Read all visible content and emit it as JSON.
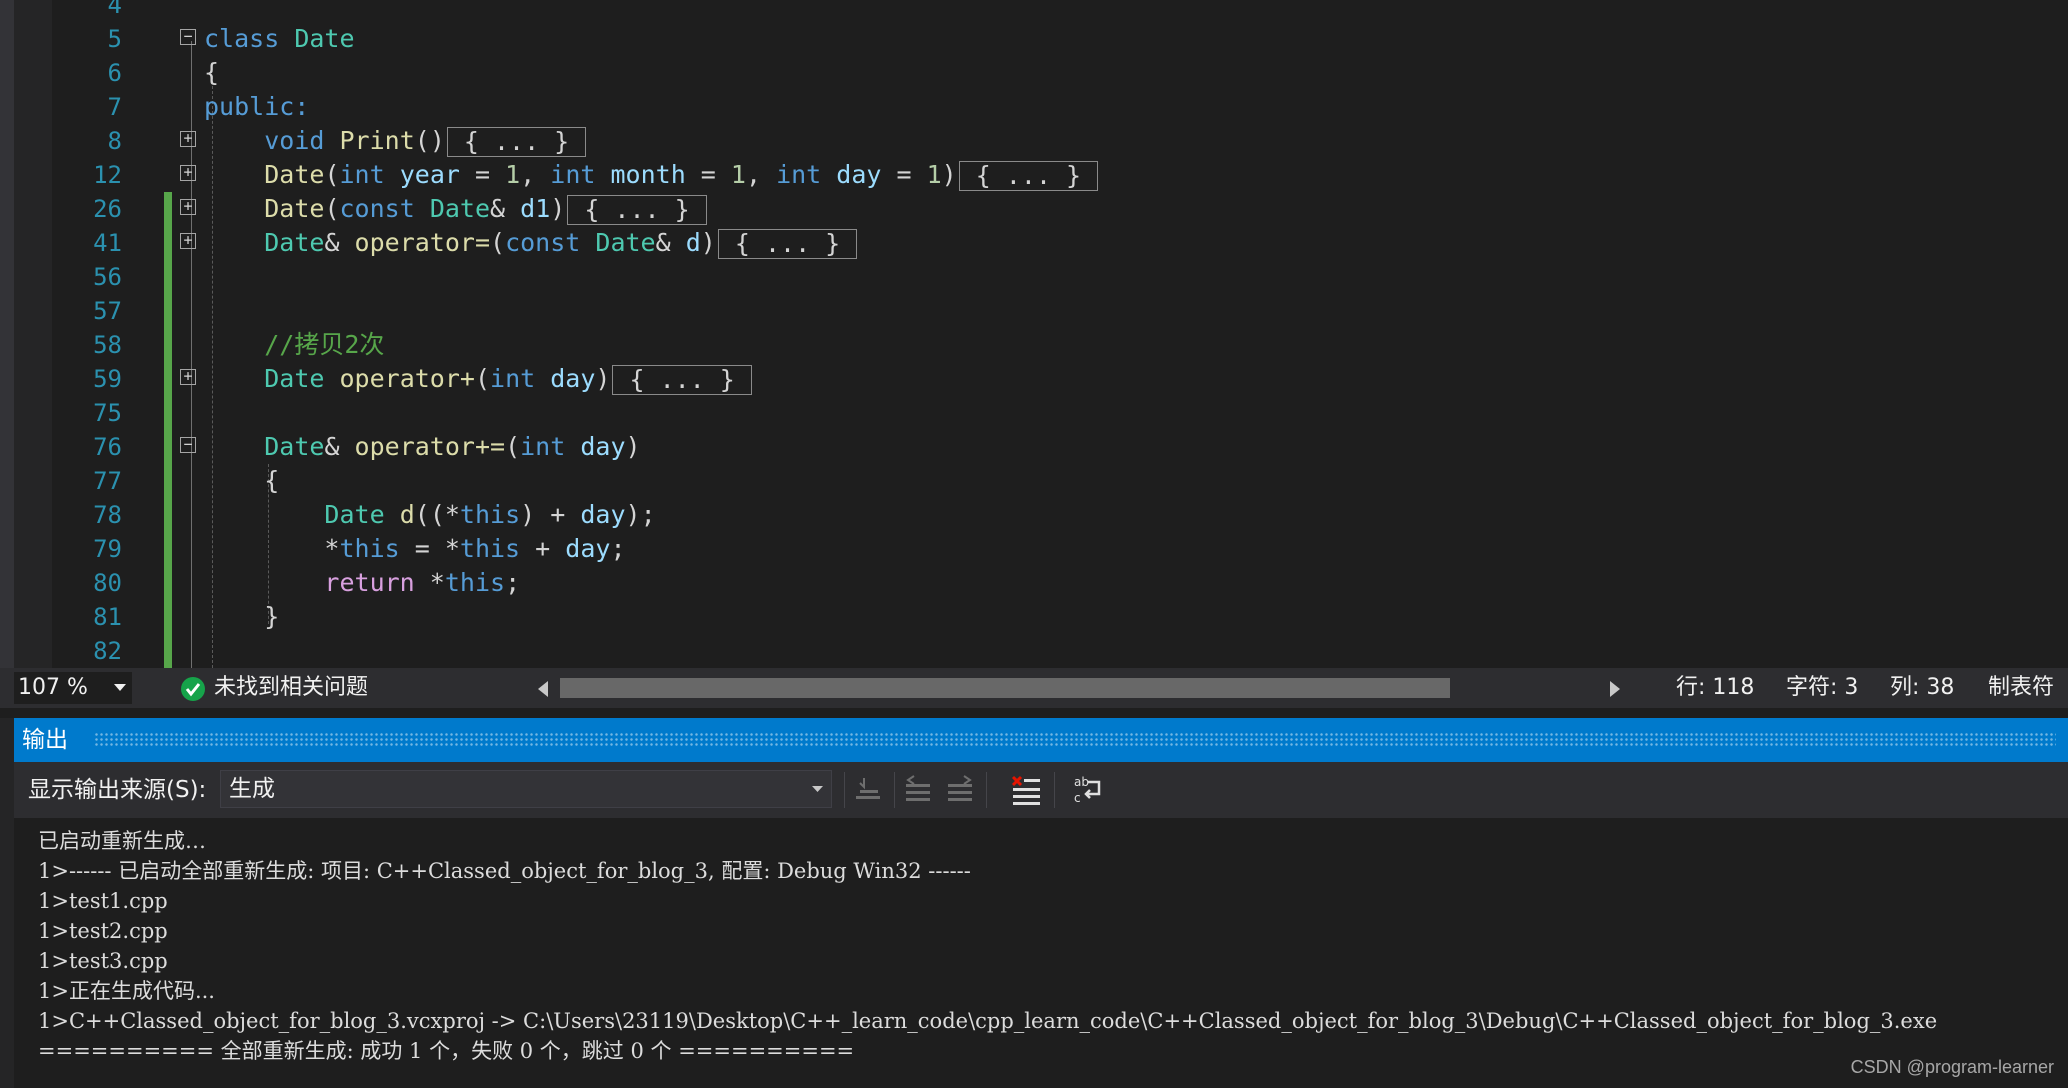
{
  "editor": {
    "line_numbers": [
      "4",
      "5",
      "6",
      "7",
      "8",
      "12",
      "26",
      "41",
      "56",
      "57",
      "58",
      "59",
      "75",
      "76",
      "77",
      "78",
      "79",
      "80",
      "81",
      "82"
    ],
    "collapsed_placeholder": "{ ... }",
    "tokens": {
      "class": "class",
      "date": "Date",
      "public": "public:",
      "brace_open": "{",
      "brace_close": "}",
      "void": "void",
      "print": "Print",
      "parens": "()",
      "int": "int",
      "year": "year",
      "month": "month",
      "day": "day",
      "one": "1",
      "const": "const",
      "d1": "d1",
      "d": "d",
      "operator_assign": "operator=",
      "operator_plus": "operator+",
      "operator_plus_assign": "operator+=",
      "comment": "//拷贝2次",
      "this": "this",
      "return": "return"
    }
  },
  "status": {
    "zoom": "107 %",
    "issues": "未找到相关问题",
    "row": "行: 118",
    "char": "字符: 3",
    "col": "列: 38",
    "tab": "制表符"
  },
  "output": {
    "title": "输出",
    "source_label": "显示输出来源(S):",
    "source_value": "生成",
    "lines": [
      "已启动重新生成…",
      "1>------ 已启动全部重新生成: 项目: C++Classed_object_for_blog_3, 配置: Debug Win32 ------",
      "1>test1.cpp",
      "1>test2.cpp",
      "1>test3.cpp",
      "1>正在生成代码...",
      "1>C++Classed_object_for_blog_3.vcxproj -> C:\\Users\\23119\\Desktop\\C++_learn_code\\cpp_learn_code\\C++Classed_object_for_blog_3\\Debug\\C++Classed_object_for_blog_3.exe",
      "========== 全部重新生成: 成功 1 个，失败 0 个，跳过 0 个 =========="
    ]
  },
  "watermark": "CSDN @program-learner",
  "colors": {
    "accent": "#007acc",
    "keyword": "#569cd6",
    "type": "#4ec9b0",
    "function": "#dcdcaa",
    "comment": "#57a64a",
    "line_number": "#2b91af"
  }
}
